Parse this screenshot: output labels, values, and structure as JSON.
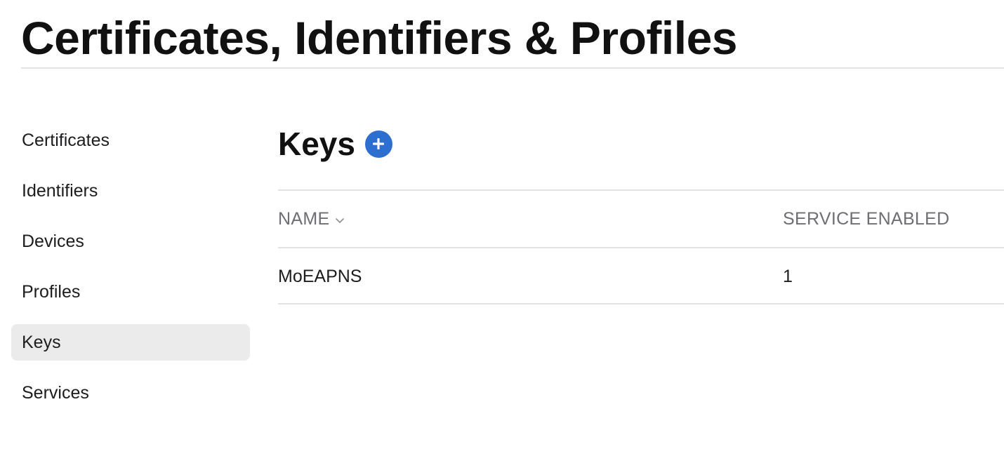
{
  "header": {
    "title": "Certificates, Identifiers & Profiles"
  },
  "sidebar": {
    "items": [
      {
        "label": "Certificates"
      },
      {
        "label": "Identifiers"
      },
      {
        "label": "Devices"
      },
      {
        "label": "Profiles"
      },
      {
        "label": "Keys",
        "selected": true
      },
      {
        "label": "Services"
      }
    ]
  },
  "main": {
    "title": "Keys",
    "add_icon": "plus-circle-icon",
    "table": {
      "columns": [
        "NAME",
        "SERVICE ENABLED"
      ],
      "sort_icon": "chevron-down-icon",
      "rows": [
        {
          "name": "MoEAPNS",
          "service_enabled": "1"
        }
      ]
    }
  },
  "colors": {
    "accent": "#2d6fd0",
    "selected_bg": "#ebebeb",
    "divider": "#e3e3e3",
    "muted_text": "#6e6e73"
  }
}
